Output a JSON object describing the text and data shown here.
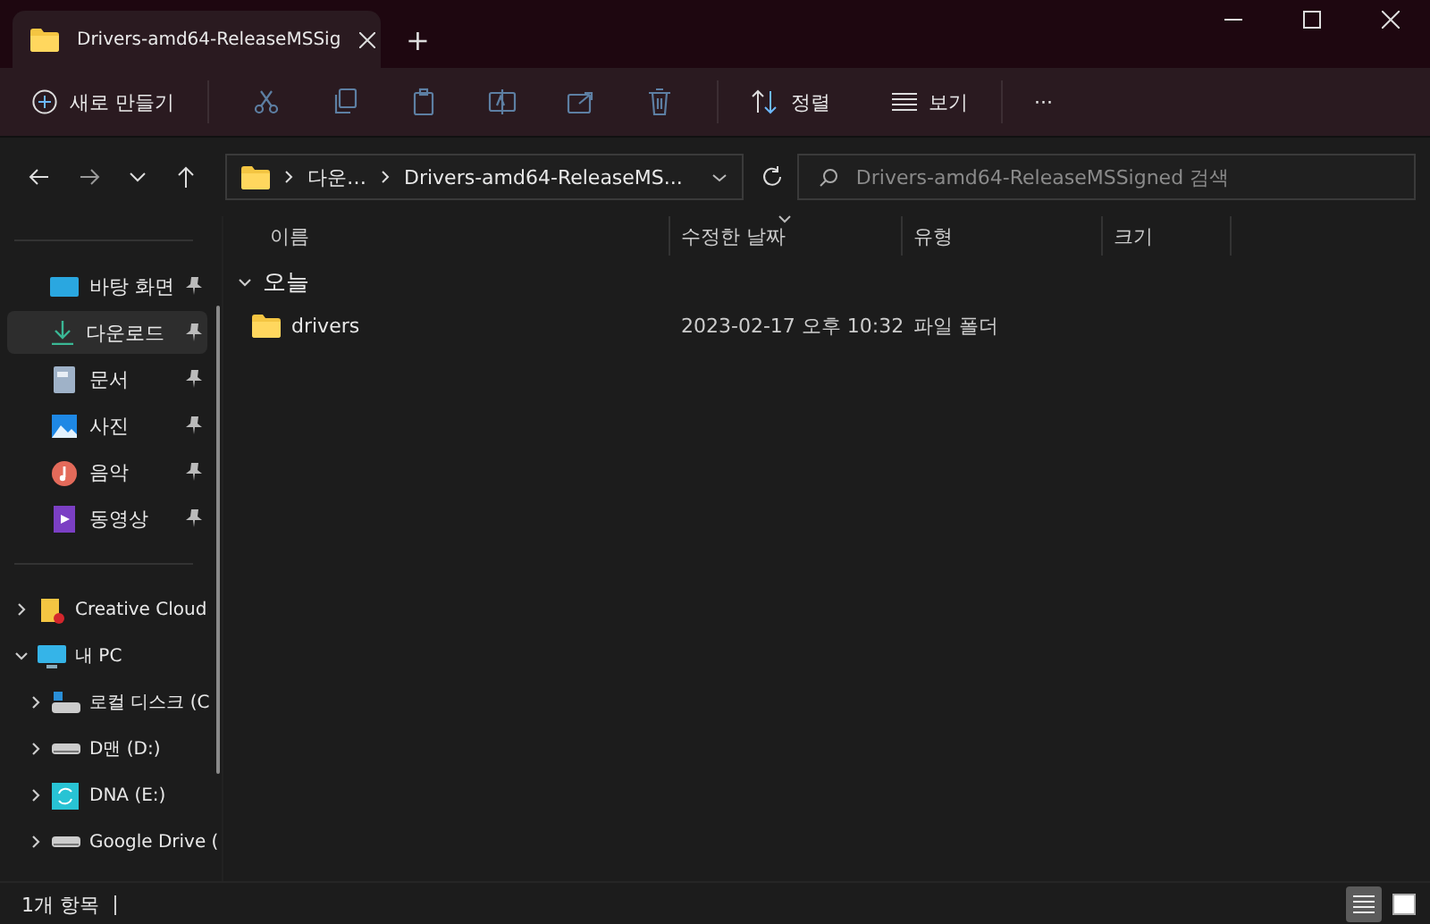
{
  "window": {
    "tab_title": "Drivers-amd64-ReleaseMSSig",
    "new_tab": "+"
  },
  "toolbar": {
    "new_label": "새로 만들기",
    "sort_label": "정렬",
    "view_label": "보기",
    "more": "···"
  },
  "nav": {
    "breadcrumbs": [
      "다운…",
      "Drivers-amd64-ReleaseMS..."
    ],
    "search_placeholder": "Drivers-amd64-ReleaseMSSigned 검색"
  },
  "sidebar": {
    "quick_access": [
      {
        "label": "바탕 화면",
        "selected": false,
        "pinned": true
      },
      {
        "label": "다운로드",
        "selected": true,
        "pinned": true
      },
      {
        "label": "문서",
        "selected": false,
        "pinned": true
      },
      {
        "label": "사진",
        "selected": false,
        "pinned": true
      },
      {
        "label": "음악",
        "selected": false,
        "pinned": true
      },
      {
        "label": "동영상",
        "selected": false,
        "pinned": true
      }
    ],
    "tree": [
      {
        "label": "Creative Cloud",
        "expanded": false
      },
      {
        "label": "내 PC",
        "expanded": true,
        "children": [
          {
            "label": "로컬 디스크 (C",
            "expanded": false
          },
          {
            "label": "D맨 (D:)",
            "expanded": false
          },
          {
            "label": "DNA (E:)",
            "expanded": false
          },
          {
            "label": "Google Drive (",
            "expanded": false
          }
        ]
      }
    ]
  },
  "table": {
    "columns": [
      {
        "label": "이름",
        "sorted": false
      },
      {
        "label": "수정한 날짜",
        "sorted": true
      },
      {
        "label": "유형",
        "sorted": false
      },
      {
        "label": "크기",
        "sorted": false
      }
    ],
    "groups": [
      {
        "label": "오늘",
        "expanded": true,
        "rows": [
          {
            "name": "drivers",
            "modified": "2023-02-17 오후 10:32",
            "type": "파일 폴더"
          }
        ]
      }
    ]
  },
  "status_bar": {
    "count": "1개 항목",
    "views": [
      {
        "kind": "details",
        "selected": true
      },
      {
        "kind": "tiles",
        "selected": false
      }
    ]
  }
}
